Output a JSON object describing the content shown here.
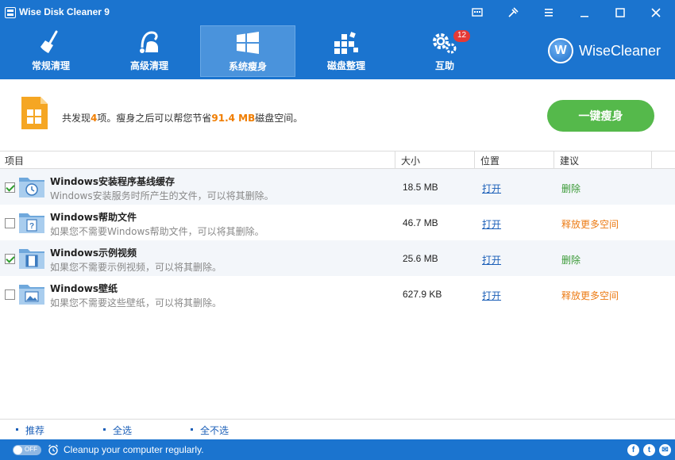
{
  "window": {
    "title": "Wise Disk Cleaner 9",
    "controls": [
      "message-icon",
      "skin-icon",
      "menu-icon",
      "minimize-icon",
      "maximize-icon",
      "close-icon"
    ]
  },
  "nav": {
    "tabs": [
      {
        "label": "常规清理",
        "icon": "broom-icon"
      },
      {
        "label": "高级清理",
        "icon": "vacuum-icon"
      },
      {
        "label": "系统瘦身",
        "icon": "windows-icon",
        "active": true
      },
      {
        "label": "磁盘整理",
        "icon": "defrag-icon"
      },
      {
        "label": "互助",
        "icon": "gears-icon",
        "badge": "12"
      }
    ]
  },
  "brand": {
    "letter": "W",
    "name": "WiseCleaner"
  },
  "summary": {
    "prefix": "共发现",
    "count": "4",
    "middle": "项。瘦身之后可以帮您节省",
    "size": "91.4 MB",
    "suffix": "磁盘空间。",
    "button": "一键瘦身"
  },
  "table": {
    "headers": {
      "item": "项目",
      "size": "大小",
      "location": "位置",
      "advice": "建议"
    },
    "rows": [
      {
        "checked": true,
        "icon": "clock-folder-icon",
        "title": "Windows安装程序基线缓存",
        "desc": "Windows安装服务时所产生的文件，可以将其删除。",
        "size": "18.5 MB",
        "location": "打开",
        "advice": "删除",
        "advice_color": "green"
      },
      {
        "checked": false,
        "icon": "help-folder-icon",
        "title": "Windows帮助文件",
        "desc": "如果您不需要Windows帮助文件，可以将其删除。",
        "size": "46.7 MB",
        "location": "打开",
        "advice": "释放更多空间",
        "advice_color": "orange"
      },
      {
        "checked": true,
        "icon": "video-folder-icon",
        "title": "Windows示例视频",
        "desc": "如果您不需要示例视频，可以将其删除。",
        "size": "25.6 MB",
        "location": "打开",
        "advice": "删除",
        "advice_color": "green"
      },
      {
        "checked": false,
        "icon": "picture-folder-icon",
        "title": "Windows壁纸",
        "desc": "如果您不需要这些壁纸，可以将其删除。",
        "size": "627.9 KB",
        "location": "打开",
        "advice": "释放更多空间",
        "advice_color": "orange"
      }
    ]
  },
  "actions": {
    "recommend": "推荐",
    "select_all": "全选",
    "select_none": "全不选"
  },
  "status": {
    "toggle": "OFF",
    "text": "Cleanup your computer regularly.",
    "social": [
      "f",
      "t",
      "✉"
    ]
  },
  "colors": {
    "header": "#1b74cf",
    "button": "#55b94b",
    "highlight": "#f07d00"
  }
}
